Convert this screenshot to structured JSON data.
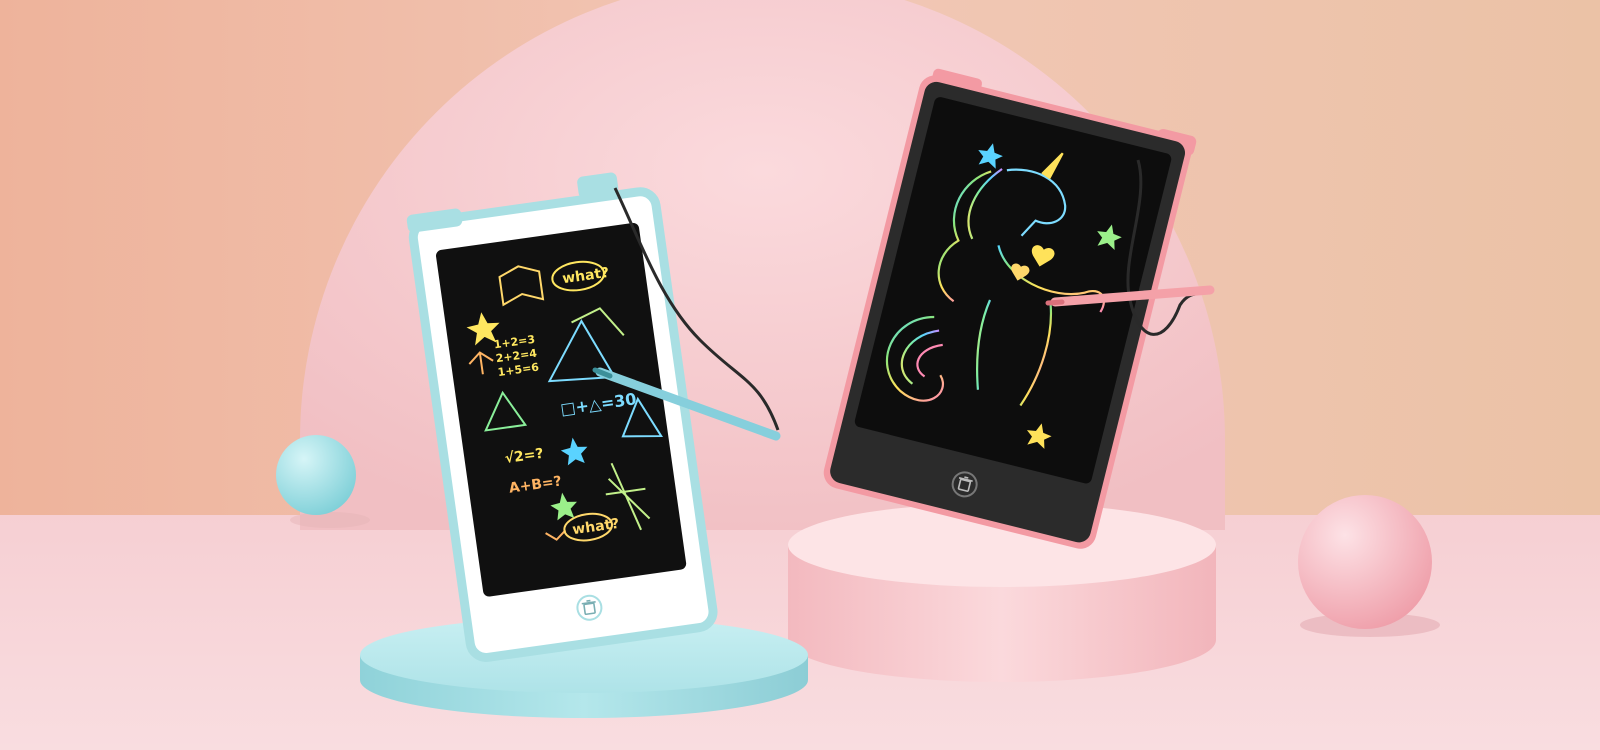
{
  "colors": {
    "wall_left": "#eeb59c",
    "wall_right": "#ecc3a6",
    "floor": "#f7d6d9",
    "arch": "#f6cdd0",
    "blue_accent": "#a8e3e6",
    "pink_accent": "#f4a1a8",
    "screen": "#101010"
  },
  "left_tablet": {
    "frame_color": "#a9dfe3",
    "doodles": {
      "bubble_top": "what?",
      "bubble_bottom": "what?",
      "equation": "□+△=30",
      "sqrt": "√2=?",
      "sum": "A+B=?",
      "math_lines": [
        "1+2=3",
        "2+2=4",
        "1+5=6"
      ]
    }
  },
  "right_tablet": {
    "frame_color": "#f39aa3",
    "drawing": "rainbow unicorn"
  },
  "icons": [
    "trash-icon",
    "stylus-icon",
    "star-icon"
  ]
}
